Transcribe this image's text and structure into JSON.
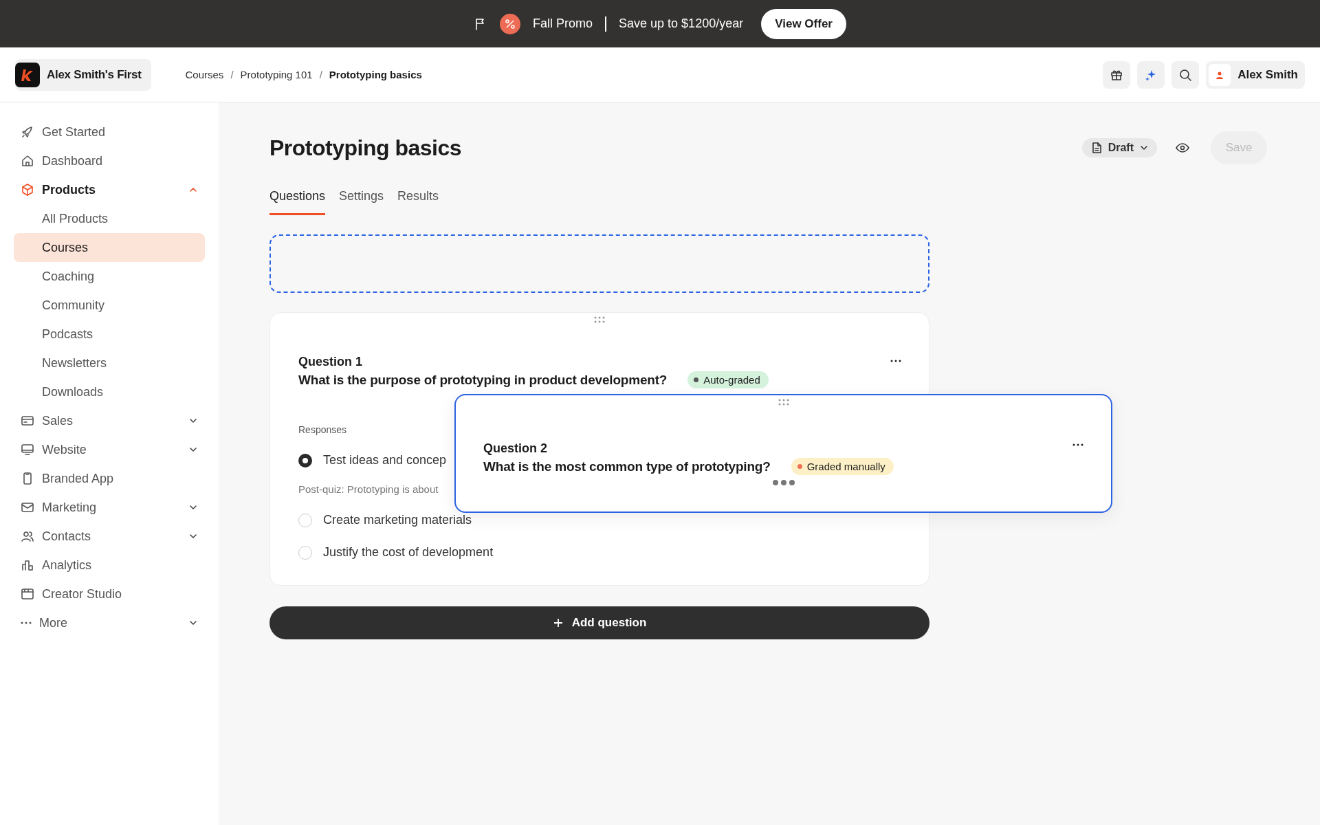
{
  "promo": {
    "title": "Fall Promo",
    "text": "Save up to $1200/year",
    "button": "View Offer"
  },
  "header": {
    "workspace": "Alex Smith's First",
    "breadcrumbs": [
      "Courses",
      "Prototyping 101",
      "Prototyping basics"
    ],
    "separators": [
      "/",
      "/"
    ],
    "user": "Alex Smith"
  },
  "sidebar": {
    "items": [
      {
        "label": "Get Started",
        "selected": false
      },
      {
        "label": "Dashboard",
        "selected": false
      },
      {
        "label": "Products",
        "selected": true,
        "expanded": true,
        "children": [
          {
            "label": "All Products",
            "selected": false
          },
          {
            "label": "Courses",
            "selected": true
          },
          {
            "label": "Coaching",
            "selected": false
          },
          {
            "label": "Community",
            "selected": false
          },
          {
            "label": "Podcasts",
            "selected": false
          },
          {
            "label": "Newsletters",
            "selected": false
          },
          {
            "label": "Downloads",
            "selected": false
          }
        ]
      },
      {
        "label": "Sales",
        "selected": false,
        "expanded": false
      },
      {
        "label": "Website",
        "selected": false,
        "expanded": false
      },
      {
        "label": "Branded App",
        "selected": false
      },
      {
        "label": "Marketing",
        "selected": false,
        "expanded": false
      },
      {
        "label": "Contacts",
        "selected": false,
        "expanded": false
      },
      {
        "label": "Analytics",
        "selected": false
      },
      {
        "label": "Creator Studio",
        "selected": false
      },
      {
        "label": "More",
        "selected": false,
        "expanded": false
      }
    ]
  },
  "page": {
    "title": "Prototyping basics",
    "status": "Draft",
    "save": {
      "label": "Save",
      "disabled": true
    },
    "tabs": [
      {
        "label": "Questions",
        "selected": true
      },
      {
        "label": "Settings",
        "selected": false
      },
      {
        "label": "Results",
        "selected": false
      }
    ]
  },
  "questions": [
    {
      "number": "Question 1",
      "text": "What is the purpose of prototyping in product development?",
      "badge": {
        "label": "Auto-graded",
        "kind": "auto"
      },
      "responses_label": "Responses",
      "options": [
        {
          "label": "Test ideas and concep",
          "selected": true,
          "note": "Post-quiz: Prototyping is about"
        },
        {
          "label": "Create marketing materials",
          "selected": false
        },
        {
          "label": "Justify the cost of development",
          "selected": false
        }
      ]
    },
    {
      "number": "Question 2",
      "text": "What is the most common type of prototyping?",
      "badge": {
        "label": "Graded manually",
        "kind": "manual"
      }
    }
  ],
  "add_button": "Add question"
}
